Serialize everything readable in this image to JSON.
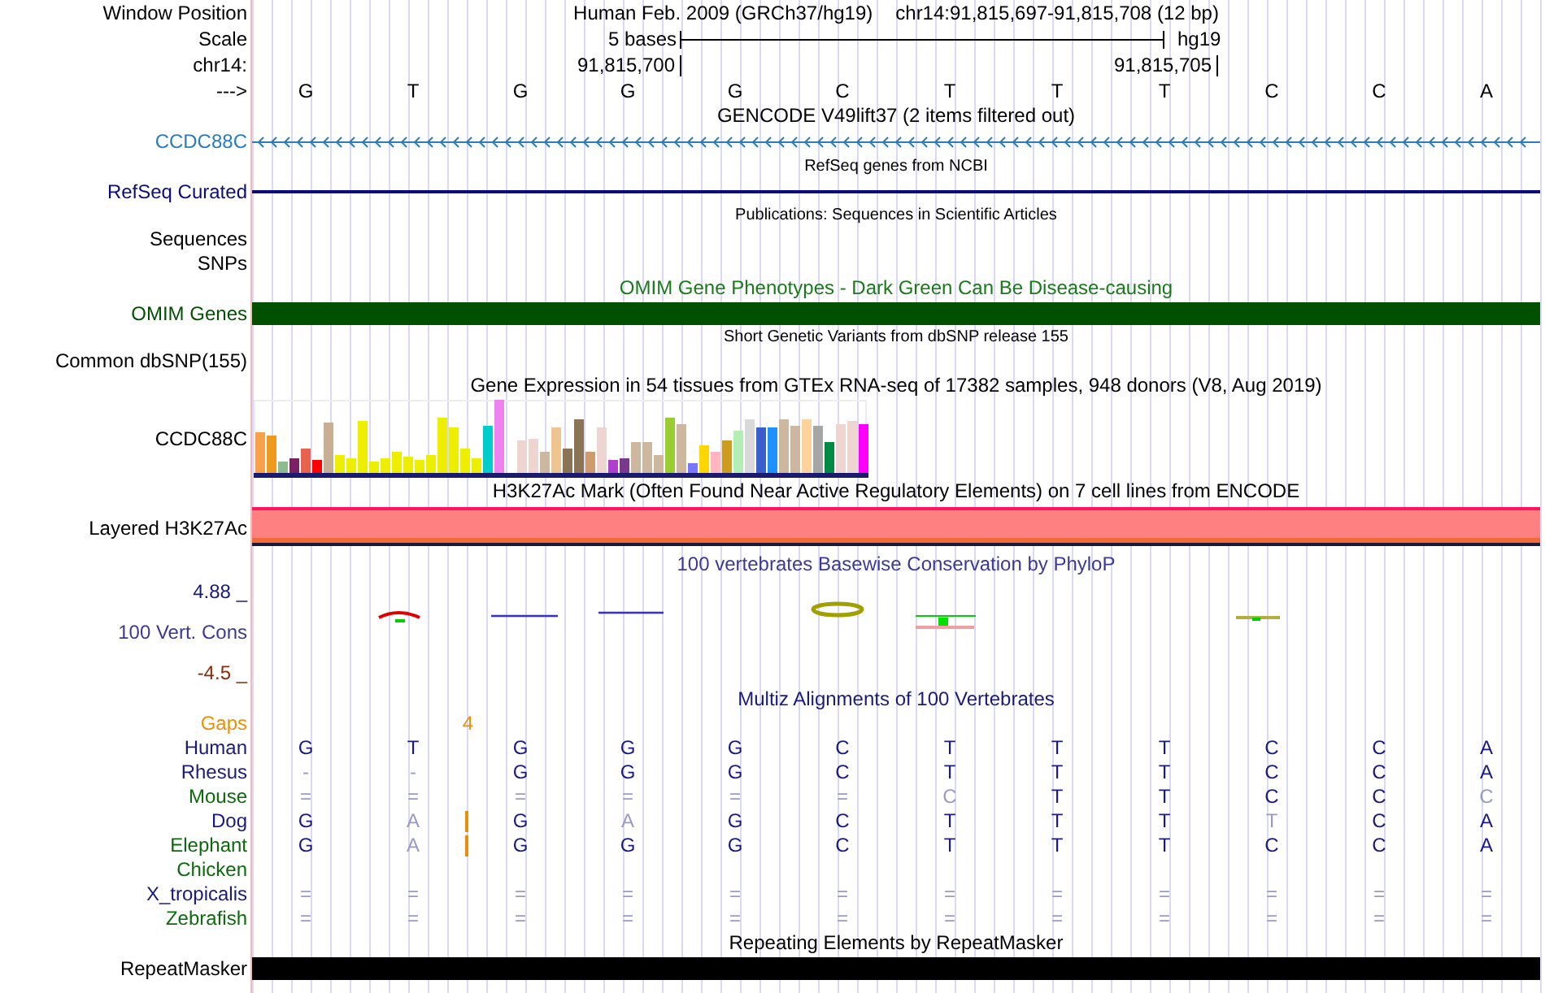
{
  "position": {
    "label": "Window Position",
    "assembly": "Human Feb. 2009 (GRCh37/hg19)",
    "range": "chr14:91,815,697-91,815,708 (12 bp)"
  },
  "scale": {
    "label": "Scale",
    "span": "5 bases",
    "assembly": "hg19"
  },
  "coordinates": {
    "label": "chr14:",
    "ticks": [
      "91,815,700",
      "91,815,705"
    ]
  },
  "sequence": {
    "label": "--->",
    "bases": [
      "G",
      "T",
      "G",
      "G",
      "G",
      "C",
      "T",
      "T",
      "T",
      "C",
      "C",
      "A"
    ]
  },
  "tracks": [
    {
      "kind": "gene",
      "title": {
        "text": "GENCODE V49lift37 (2 items filtered out)",
        "color": "#000000"
      },
      "labels": [
        "CCDC88C"
      ],
      "color": "#2b7bbd"
    },
    {
      "kind": "line",
      "title": {
        "text": "RefSeq genes from NCBI",
        "color": "#000000"
      },
      "labels": [
        "RefSeq Curated"
      ],
      "color": "#0c0c78"
    },
    {
      "kind": "empty",
      "title": {
        "text": "Publications: Sequences in Scientific Articles",
        "color": "#000000"
      },
      "labels": [
        "Sequences",
        "SNPs"
      ],
      "color": "#000000"
    },
    {
      "kind": "block",
      "title": {
        "text": "OMIM Gene Phenotypes - Dark Green Can Be Disease-causing",
        "color": "#1a7a1a"
      },
      "labels": [
        "OMIM Genes"
      ],
      "color": "#005000"
    },
    {
      "kind": "empty",
      "title": {
        "text": "Short Genetic Variants from dbSNP release 155",
        "color": "#000000"
      },
      "labels": [
        "Common dbSNP(155)"
      ],
      "color": "#000000"
    },
    {
      "kind": "expression",
      "title": {
        "text": "Gene Expression in 54 tissues from GTEx RNA-seq of 17382 samples, 948 donors (V8, Aug 2019)",
        "color": "#000000"
      },
      "labels": [
        "CCDC88C"
      ],
      "color": "#000000"
    },
    {
      "kind": "layered",
      "title": {
        "text": "H3K27Ac Mark (Often Found Near Active Regulatory Elements) on 7 cell lines from ENCODE",
        "color": "#000000"
      },
      "labels": [
        "Layered H3K27Ac"
      ],
      "color": "#000000"
    },
    {
      "kind": "conservation",
      "title": {
        "text": "100 vertebrates Basewise Conservation by PhyloP",
        "color": "#3a3a96"
      },
      "labels": [
        "100 Vert. Cons"
      ],
      "color": "#3a3a96",
      "axis_max": "4.88 _",
      "axis_min": "-4.5 _"
    },
    {
      "kind": "multiz",
      "title": {
        "text": "Multiz Alignments of 100 Vertebrates",
        "color": "#1a1a7a"
      },
      "gaps": {
        "label": "Gaps",
        "color": "#e8900a",
        "marks": [
          "4"
        ]
      },
      "species": [
        {
          "name": "Human",
          "color": "#1a1a7a",
          "insertion": false,
          "bases": [
            {
              "b": "G",
              "faded": false
            },
            {
              "b": "T",
              "faded": false
            },
            {
              "b": "G",
              "faded": false
            },
            {
              "b": "G",
              "faded": false
            },
            {
              "b": "G",
              "faded": false
            },
            {
              "b": "C",
              "faded": false
            },
            {
              "b": "T",
              "faded": false
            },
            {
              "b": "T",
              "faded": false
            },
            {
              "b": "T",
              "faded": false
            },
            {
              "b": "C",
              "faded": false
            },
            {
              "b": "C",
              "faded": false
            },
            {
              "b": "A",
              "faded": false
            }
          ]
        },
        {
          "name": "Rhesus",
          "color": "#1a1a7a",
          "insertion": false,
          "bases": [
            {
              "b": "-",
              "faded": true
            },
            {
              "b": "-",
              "faded": true
            },
            {
              "b": "G",
              "faded": false
            },
            {
              "b": "G",
              "faded": false
            },
            {
              "b": "G",
              "faded": false
            },
            {
              "b": "C",
              "faded": false
            },
            {
              "b": "T",
              "faded": false
            },
            {
              "b": "T",
              "faded": false
            },
            {
              "b": "T",
              "faded": false
            },
            {
              "b": "C",
              "faded": false
            },
            {
              "b": "C",
              "faded": false
            },
            {
              "b": "A",
              "faded": false
            }
          ]
        },
        {
          "name": "Mouse",
          "color": "#0c6a0c",
          "insertion": false,
          "bases": [
            {
              "b": "=",
              "faded": true
            },
            {
              "b": "=",
              "faded": true
            },
            {
              "b": "=",
              "faded": true
            },
            {
              "b": "=",
              "faded": true
            },
            {
              "b": "=",
              "faded": true
            },
            {
              "b": "=",
              "faded": true
            },
            {
              "b": "C",
              "faded": true
            },
            {
              "b": "T",
              "faded": false
            },
            {
              "b": "T",
              "faded": false
            },
            {
              "b": "C",
              "faded": false
            },
            {
              "b": "C",
              "faded": false
            },
            {
              "b": "C",
              "faded": true
            }
          ]
        },
        {
          "name": "Dog",
          "color": "#1a1a7a",
          "insertion": true,
          "bases": [
            {
              "b": "G",
              "faded": false
            },
            {
              "b": "A",
              "faded": true
            },
            {
              "b": "G",
              "faded": false
            },
            {
              "b": "A",
              "faded": true
            },
            {
              "b": "G",
              "faded": false
            },
            {
              "b": "C",
              "faded": false
            },
            {
              "b": "T",
              "faded": false
            },
            {
              "b": "T",
              "faded": false
            },
            {
              "b": "T",
              "faded": false
            },
            {
              "b": "T",
              "faded": true
            },
            {
              "b": "C",
              "faded": false
            },
            {
              "b": "A",
              "faded": false
            }
          ]
        },
        {
          "name": "Elephant",
          "color": "#0c6a0c",
          "insertion": true,
          "bases": [
            {
              "b": "G",
              "faded": false
            },
            {
              "b": "A",
              "faded": true
            },
            {
              "b": "G",
              "faded": false
            },
            {
              "b": "G",
              "faded": false
            },
            {
              "b": "G",
              "faded": false
            },
            {
              "b": "C",
              "faded": false
            },
            {
              "b": "T",
              "faded": false
            },
            {
              "b": "T",
              "faded": false
            },
            {
              "b": "T",
              "faded": false
            },
            {
              "b": "C",
              "faded": false
            },
            {
              "b": "C",
              "faded": false
            },
            {
              "b": "A",
              "faded": false
            }
          ]
        },
        {
          "name": "Chicken",
          "color": "#0c6a0c",
          "insertion": false
        },
        {
          "name": "X_tropicalis",
          "color": "#1a1a7a",
          "insertion": false,
          "bases": [
            {
              "b": "=",
              "faded": true
            },
            {
              "b": "=",
              "faded": true
            },
            {
              "b": "=",
              "faded": true
            },
            {
              "b": "=",
              "faded": true
            },
            {
              "b": "=",
              "faded": true
            },
            {
              "b": "=",
              "faded": true
            },
            {
              "b": "=",
              "faded": true
            },
            {
              "b": "=",
              "faded": true
            },
            {
              "b": "=",
              "faded": true
            },
            {
              "b": "=",
              "faded": true
            },
            {
              "b": "=",
              "faded": true
            },
            {
              "b": "=",
              "faded": true
            }
          ]
        },
        {
          "name": "Zebrafish",
          "color": "#0c6a0c",
          "insertion": false,
          "bases": [
            {
              "b": "=",
              "faded": true
            },
            {
              "b": "=",
              "faded": true
            },
            {
              "b": "=",
              "faded": true
            },
            {
              "b": "=",
              "faded": true
            },
            {
              "b": "=",
              "faded": true
            },
            {
              "b": "=",
              "faded": true
            },
            {
              "b": "=",
              "faded": true
            },
            {
              "b": "=",
              "faded": true
            },
            {
              "b": "=",
              "faded": true
            },
            {
              "b": "=",
              "faded": true
            },
            {
              "b": "=",
              "faded": true
            },
            {
              "b": "=",
              "faded": true
            }
          ]
        }
      ]
    },
    {
      "kind": "block",
      "title": {
        "text": "Repeating Elements by RepeatMasker",
        "color": "#000000"
      },
      "labels": [
        "RepeatMasker"
      ],
      "color": "#000000"
    }
  ]
}
